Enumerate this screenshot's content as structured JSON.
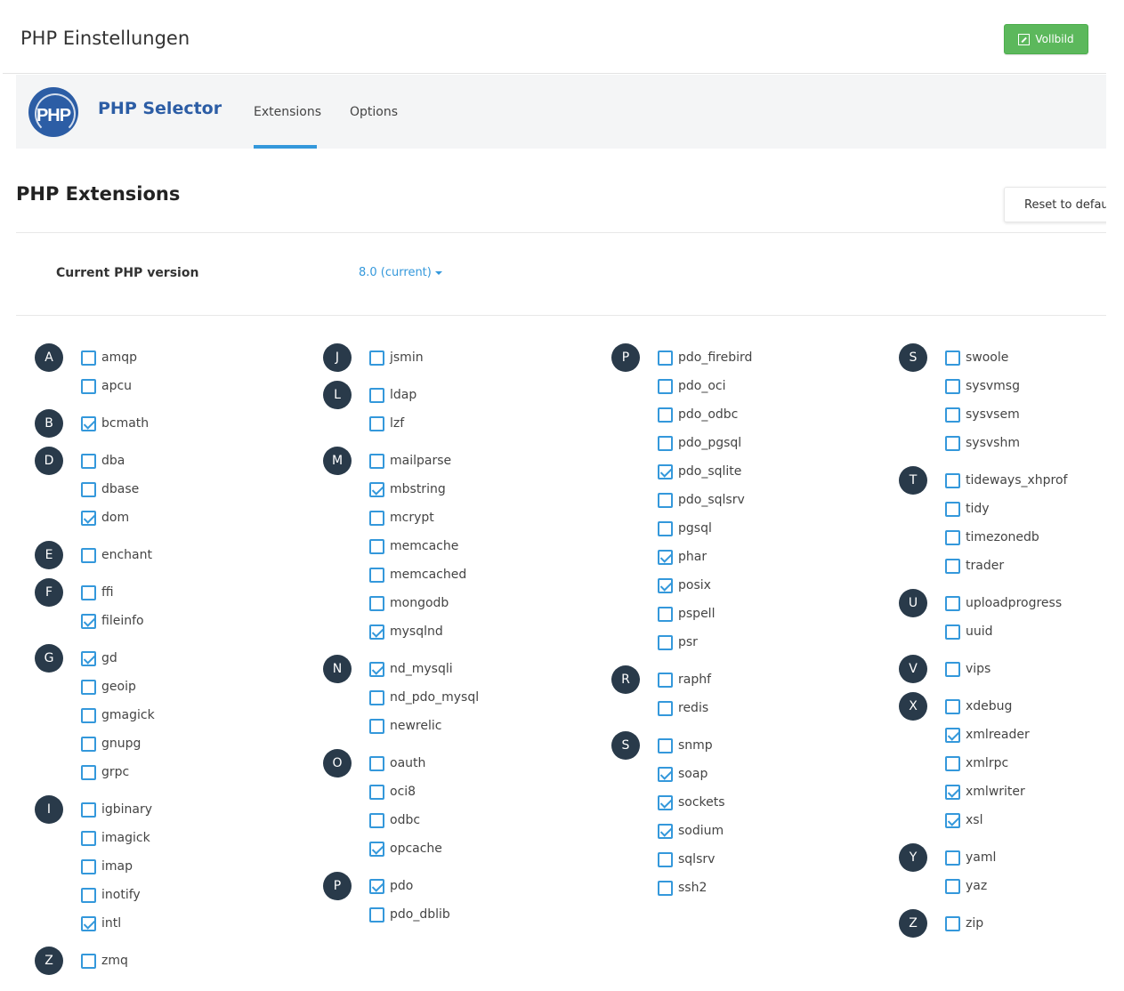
{
  "header": {
    "title": "PHP Einstellungen",
    "fullscreen_label": "Vollbild"
  },
  "selector": {
    "logo_text": "PHP",
    "title": "PHP Selector",
    "tabs": [
      {
        "label": "Extensions",
        "active": true
      },
      {
        "label": "Options",
        "active": false
      }
    ]
  },
  "section": {
    "title": "PHP Extensions",
    "reset_label": "Reset to default"
  },
  "version": {
    "label": "Current PHP version",
    "value": "8.0 (current)"
  },
  "colors": {
    "accent": "#3498db",
    "brand": "#2c5da5",
    "letter_badge": "#293a4a",
    "success": "#5cb85c"
  },
  "columns": [
    {
      "groups": [
        {
          "letter": "A",
          "items": [
            {
              "name": "amqp",
              "checked": false
            },
            {
              "name": "apcu",
              "checked": false
            }
          ]
        },
        {
          "letter": "B",
          "items": [
            {
              "name": "bcmath",
              "checked": true
            }
          ]
        },
        {
          "letter": "D",
          "items": [
            {
              "name": "dba",
              "checked": false
            },
            {
              "name": "dbase",
              "checked": false
            },
            {
              "name": "dom",
              "checked": true
            }
          ]
        },
        {
          "letter": "E",
          "items": [
            {
              "name": "enchant",
              "checked": false
            }
          ]
        },
        {
          "letter": "F",
          "items": [
            {
              "name": "ffi",
              "checked": false
            },
            {
              "name": "fileinfo",
              "checked": true
            }
          ]
        },
        {
          "letter": "G",
          "items": [
            {
              "name": "gd",
              "checked": true
            },
            {
              "name": "geoip",
              "checked": false
            },
            {
              "name": "gmagick",
              "checked": false
            },
            {
              "name": "gnupg",
              "checked": false
            },
            {
              "name": "grpc",
              "checked": false
            }
          ]
        },
        {
          "letter": "I",
          "items": [
            {
              "name": "igbinary",
              "checked": false
            },
            {
              "name": "imagick",
              "checked": false
            },
            {
              "name": "imap",
              "checked": false
            },
            {
              "name": "inotify",
              "checked": false
            },
            {
              "name": "intl",
              "checked": true
            }
          ]
        },
        {
          "letter": "Z",
          "items": [
            {
              "name": "zmq",
              "checked": false
            }
          ]
        }
      ]
    },
    {
      "groups": [
        {
          "letter": "J",
          "items": [
            {
              "name": "jsmin",
              "checked": false
            }
          ]
        },
        {
          "letter": "L",
          "items": [
            {
              "name": "ldap",
              "checked": false
            },
            {
              "name": "lzf",
              "checked": false
            }
          ]
        },
        {
          "letter": "M",
          "items": [
            {
              "name": "mailparse",
              "checked": false
            },
            {
              "name": "mbstring",
              "checked": true
            },
            {
              "name": "mcrypt",
              "checked": false
            },
            {
              "name": "memcache",
              "checked": false
            },
            {
              "name": "memcached",
              "checked": false
            },
            {
              "name": "mongodb",
              "checked": false
            },
            {
              "name": "mysqlnd",
              "checked": true
            }
          ]
        },
        {
          "letter": "N",
          "items": [
            {
              "name": "nd_mysqli",
              "checked": true
            },
            {
              "name": "nd_pdo_mysql",
              "checked": false
            },
            {
              "name": "newrelic",
              "checked": false
            }
          ]
        },
        {
          "letter": "O",
          "items": [
            {
              "name": "oauth",
              "checked": false
            },
            {
              "name": "oci8",
              "checked": false
            },
            {
              "name": "odbc",
              "checked": false
            },
            {
              "name": "opcache",
              "checked": true
            }
          ]
        },
        {
          "letter": "P",
          "items": [
            {
              "name": "pdo",
              "checked": true
            },
            {
              "name": "pdo_dblib",
              "checked": false
            }
          ]
        }
      ]
    },
    {
      "groups": [
        {
          "letter": "P",
          "items": [
            {
              "name": "pdo_firebird",
              "checked": false
            },
            {
              "name": "pdo_oci",
              "checked": false
            },
            {
              "name": "pdo_odbc",
              "checked": false
            },
            {
              "name": "pdo_pgsql",
              "checked": false
            },
            {
              "name": "pdo_sqlite",
              "checked": true
            },
            {
              "name": "pdo_sqlsrv",
              "checked": false
            },
            {
              "name": "pgsql",
              "checked": false
            },
            {
              "name": "phar",
              "checked": true
            },
            {
              "name": "posix",
              "checked": true
            },
            {
              "name": "pspell",
              "checked": false
            },
            {
              "name": "psr",
              "checked": false
            }
          ]
        },
        {
          "letter": "R",
          "items": [
            {
              "name": "raphf",
              "checked": false
            },
            {
              "name": "redis",
              "checked": false
            }
          ]
        },
        {
          "letter": "S",
          "items": [
            {
              "name": "snmp",
              "checked": false
            },
            {
              "name": "soap",
              "checked": true
            },
            {
              "name": "sockets",
              "checked": true
            },
            {
              "name": "sodium",
              "checked": true
            },
            {
              "name": "sqlsrv",
              "checked": false
            },
            {
              "name": "ssh2",
              "checked": false
            }
          ]
        }
      ]
    },
    {
      "groups": [
        {
          "letter": "S",
          "items": [
            {
              "name": "swoole",
              "checked": false
            },
            {
              "name": "sysvmsg",
              "checked": false
            },
            {
              "name": "sysvsem",
              "checked": false
            },
            {
              "name": "sysvshm",
              "checked": false
            }
          ]
        },
        {
          "letter": "T",
          "items": [
            {
              "name": "tideways_xhprof",
              "checked": false
            },
            {
              "name": "tidy",
              "checked": false
            },
            {
              "name": "timezonedb",
              "checked": false
            },
            {
              "name": "trader",
              "checked": false
            }
          ]
        },
        {
          "letter": "U",
          "items": [
            {
              "name": "uploadprogress",
              "checked": false
            },
            {
              "name": "uuid",
              "checked": false
            }
          ]
        },
        {
          "letter": "V",
          "items": [
            {
              "name": "vips",
              "checked": false
            }
          ]
        },
        {
          "letter": "X",
          "items": [
            {
              "name": "xdebug",
              "checked": false
            },
            {
              "name": "xmlreader",
              "checked": true
            },
            {
              "name": "xmlrpc",
              "checked": false
            },
            {
              "name": "xmlwriter",
              "checked": true
            },
            {
              "name": "xsl",
              "checked": true
            }
          ]
        },
        {
          "letter": "Y",
          "items": [
            {
              "name": "yaml",
              "checked": false
            },
            {
              "name": "yaz",
              "checked": false
            }
          ]
        },
        {
          "letter": "Z",
          "items": [
            {
              "name": "zip",
              "checked": false
            }
          ]
        }
      ]
    }
  ]
}
